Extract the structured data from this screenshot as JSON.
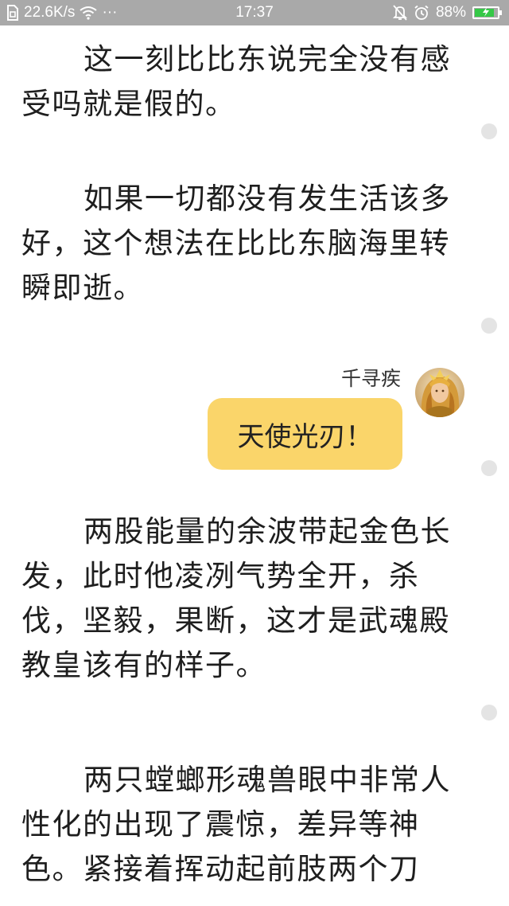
{
  "status_bar": {
    "network_speed": "22.6K/s",
    "more": "···",
    "time": "17:37",
    "battery_percent": "88%",
    "battery_level": 0.88,
    "battery_color": "#35c847",
    "icons": [
      "sim-icon",
      "wifi-icon",
      "bell-muted-icon",
      "alarm-clock-icon",
      "battery-charging-icon"
    ]
  },
  "reader": {
    "paragraphs": [
      "这一刻比比东说完全没有感受吗就是假的。",
      "如果一切都没有发生活该多好，这个想法在比比东脑海里转瞬即逝。",
      "两股能量的余波带起金色长发，此时他凌冽气势全开，杀伐，坚毅，果断，这才是武魂殿教皇该有的样子。",
      "两只螳螂形魂兽眼中非常人性化的出现了震惊，差异等神色。紧接着挥动起前肢两个刀"
    ],
    "dialogue": {
      "speaker": "千寻疾",
      "message": "天使光刃！",
      "bubble_color": "#fad56a",
      "avatar_icon": "golden-warrior-avatar"
    }
  }
}
